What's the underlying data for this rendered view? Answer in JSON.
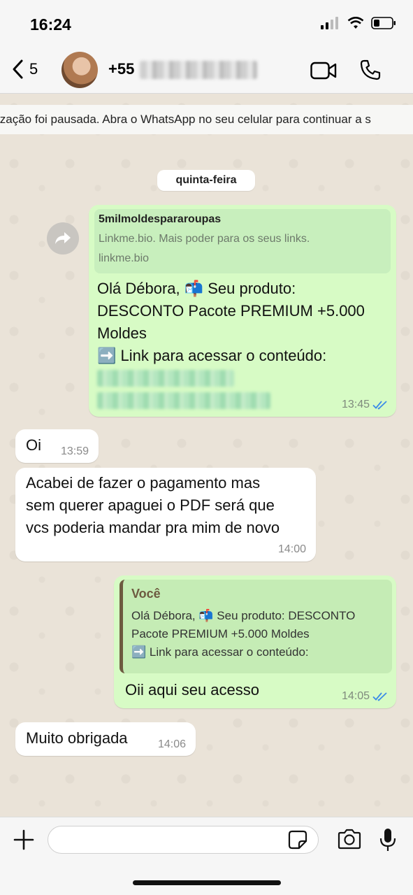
{
  "status_bar": {
    "time": "16:24"
  },
  "header": {
    "back_count": "5",
    "contact_prefix": "+55",
    "contact_hidden": true
  },
  "sync_banner": "ização foi pausada. Abra o WhatsApp no seu celular para continuar a s",
  "date_separator": "quinta-feira",
  "messages": {
    "m1": {
      "preview_title": "5milmoldespararoupas",
      "preview_desc": "Linkme.bio. Mais poder para os seus links.",
      "preview_domain": "linkme.bio",
      "line1": "Olá Débora, 📬 Seu produto:",
      "line2": "DESCONTO Pacote PREMIUM +5.000",
      "line3": "Moldes",
      "line4": "➡️ Link para acessar o conteúdo:",
      "time": "13:45"
    },
    "m2": {
      "text": "Oi",
      "time": "13:59"
    },
    "m3": {
      "line1": "Acabei de fazer o pagamento mas",
      "line2": "sem querer apaguei o PDF será que",
      "line3": "vcs poderia mandar pra mim de novo",
      "time": "14:00"
    },
    "m4": {
      "quote_author": "Você",
      "quote_line1": "Olá Débora, 📬 Seu produto: DESCONTO",
      "quote_line2": "Pacote PREMIUM +5.000 Moldes",
      "quote_line3": "➡️ Link para acessar o conteúdo:",
      "text": "Oii aqui seu acesso",
      "time": "14:05"
    },
    "m5": {
      "text": "Muito obrigada",
      "time": "14:06"
    }
  },
  "input": {
    "value": "",
    "placeholder": ""
  },
  "colors": {
    "outgoing_bubble": "#d7fbc5",
    "incoming_bubble": "#ffffff",
    "read_ticks": "#3b8be8",
    "chat_background": "#eae3d8"
  },
  "icons": [
    "back-chevron-icon",
    "video-call-icon",
    "phone-icon",
    "forward-icon",
    "double-check-icon",
    "plus-icon",
    "sticker-icon",
    "camera-icon",
    "microphone-icon",
    "signal-icon",
    "wifi-icon",
    "battery-icon"
  ]
}
